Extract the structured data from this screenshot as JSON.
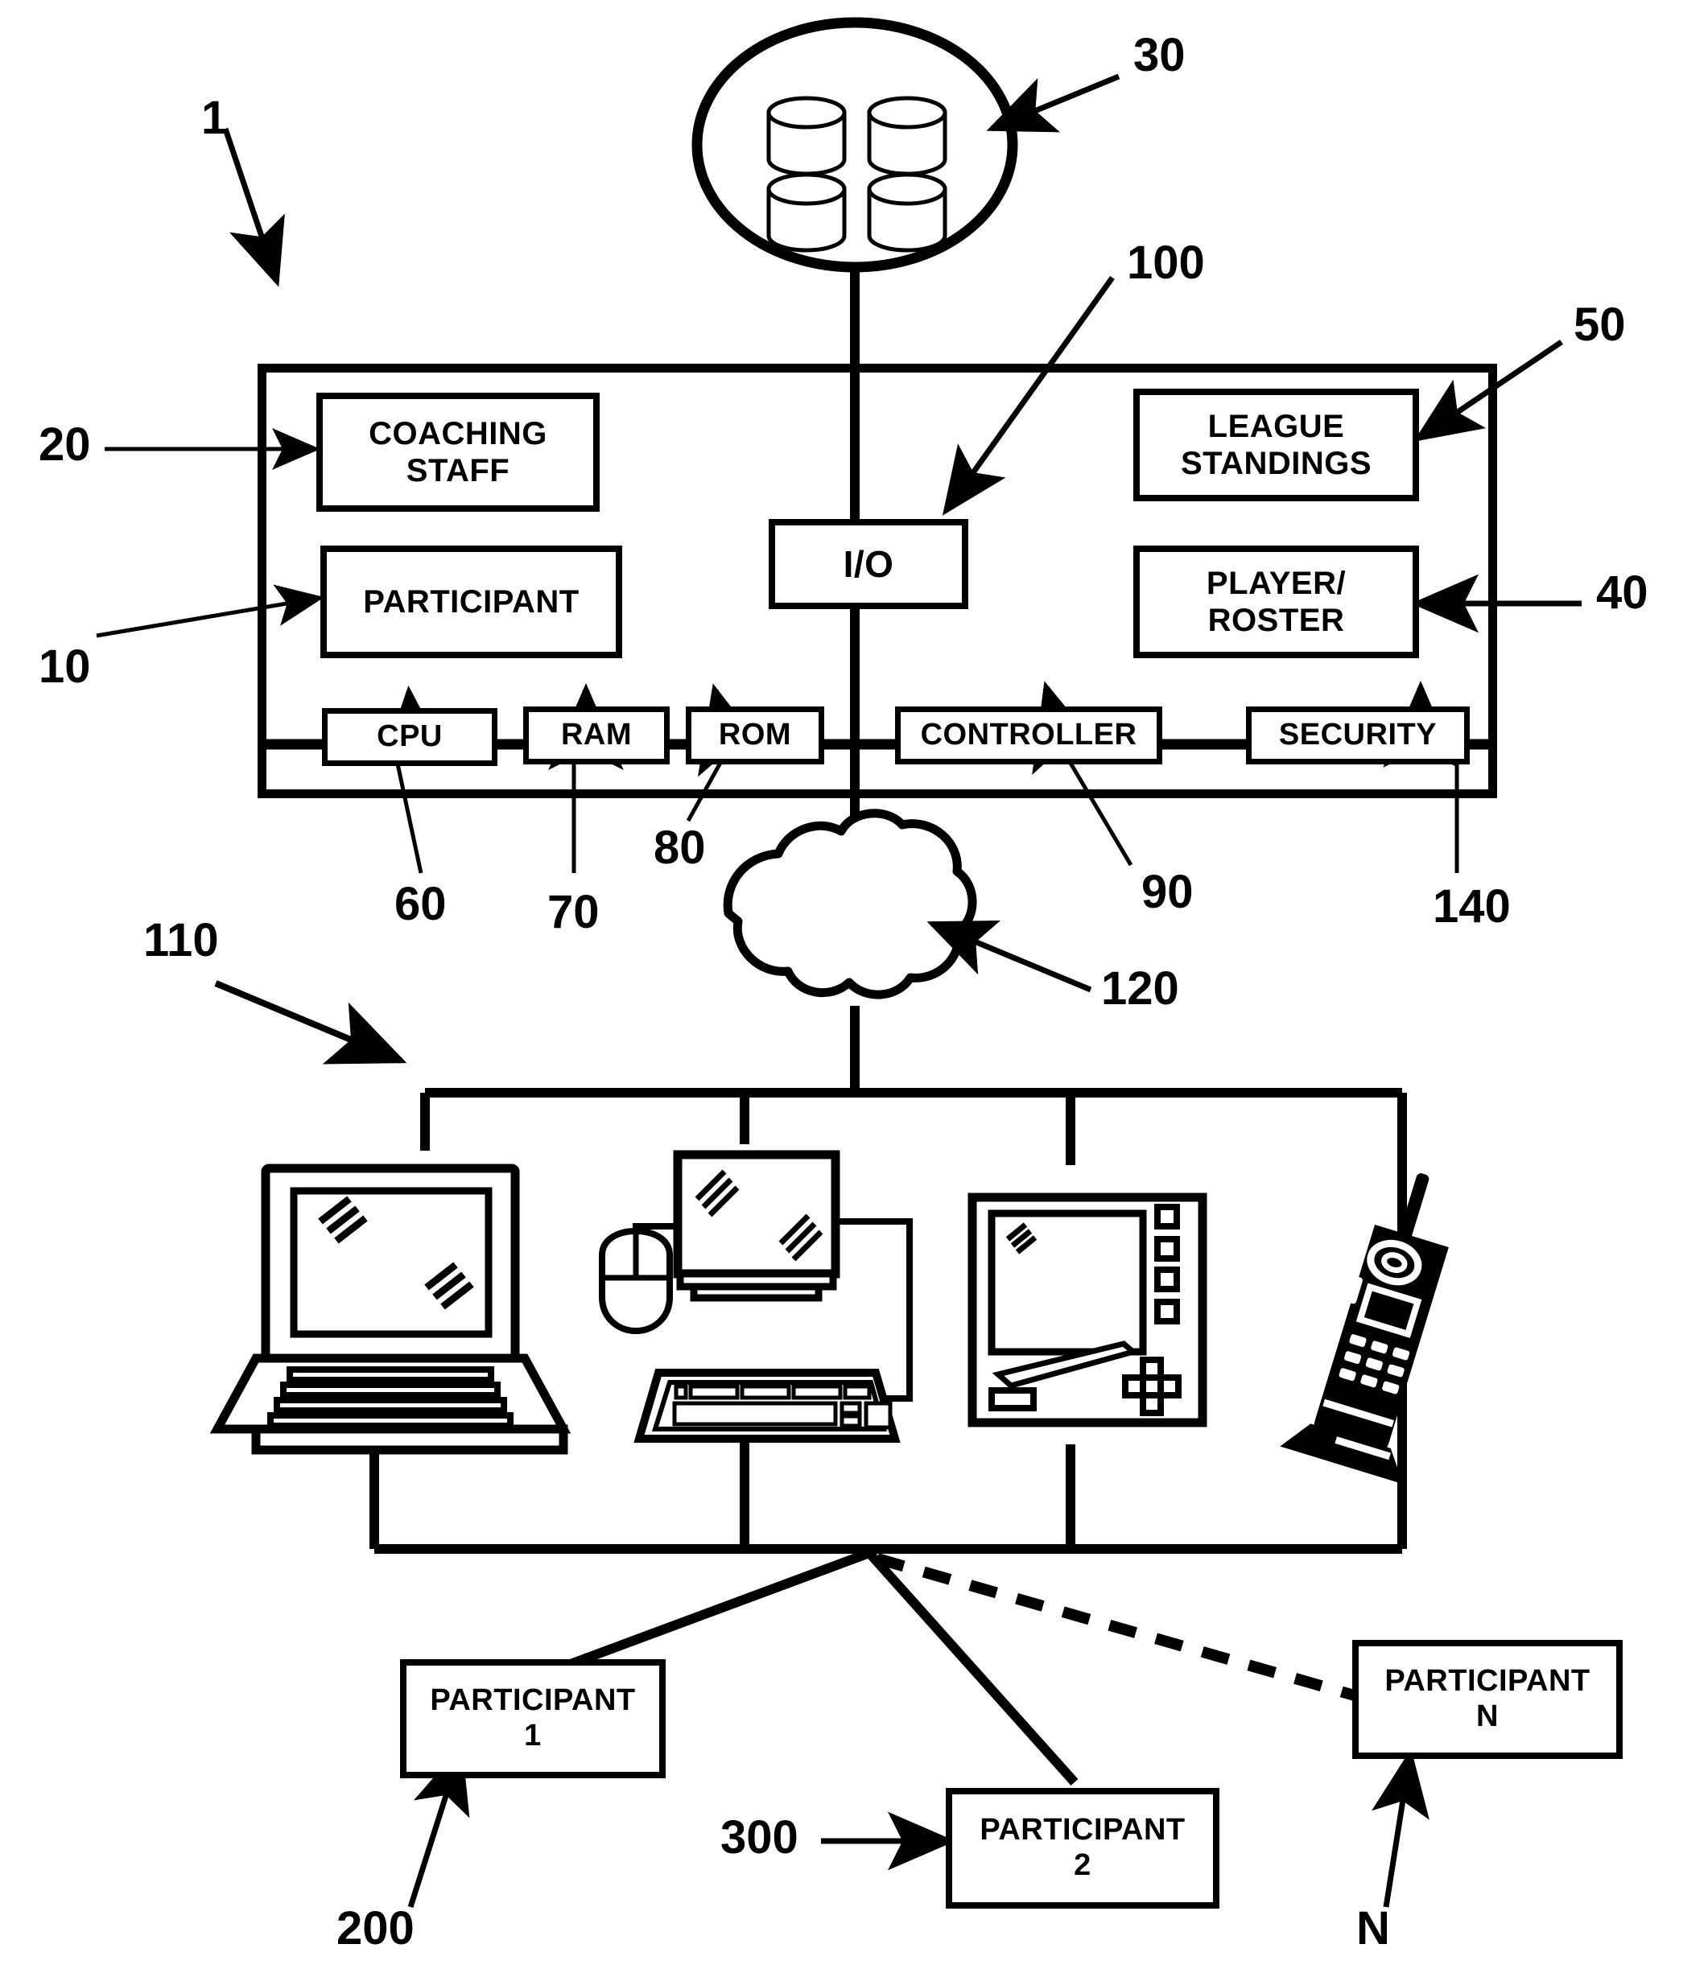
{
  "figure": {
    "type": "patent-system-block-diagram",
    "ink_color": "#000000",
    "background_color": "#ffffff"
  },
  "server_system": {
    "frame_ref": "1",
    "blocks": [
      {
        "id": "coaching_staff",
        "label": "COACHING\nSTAFF",
        "ref": "20"
      },
      {
        "id": "participant",
        "label": "PARTICIPANT",
        "ref": "10"
      },
      {
        "id": "io",
        "label": "I/O",
        "ref": "100"
      },
      {
        "id": "league_standings",
        "label": "LEAGUE\nSTANDINGS",
        "ref": "50"
      },
      {
        "id": "player_roster",
        "label": "PLAYER/\nROSTER",
        "ref": "40"
      },
      {
        "id": "cpu",
        "label": "CPU",
        "ref": "60"
      },
      {
        "id": "ram",
        "label": "RAM",
        "ref": "70"
      },
      {
        "id": "rom",
        "label": "ROM",
        "ref": "80"
      },
      {
        "id": "controller",
        "label": "CONTROLLER",
        "ref": "90"
      },
      {
        "id": "security",
        "label": "SECURITY",
        "ref": "140"
      }
    ]
  },
  "database": {
    "ref": "30",
    "icon": "database-cluster-icon",
    "cylinder_count": 4
  },
  "network": {
    "ref": "120",
    "icon": "cloud-icon"
  },
  "client_devices": {
    "ref": "110",
    "items": [
      {
        "id": "laptop",
        "icon": "laptop-icon"
      },
      {
        "id": "desktop",
        "icon": "desktop-computer-icon"
      },
      {
        "id": "pda",
        "icon": "pda-tablet-icon"
      },
      {
        "id": "mobile_phone",
        "icon": "mobile-phone-icon"
      }
    ]
  },
  "participants": [
    {
      "id": "participant_1",
      "label": "PARTICIPANT\n1",
      "ref": "200",
      "line_style": "solid"
    },
    {
      "id": "participant_2",
      "label": "PARTICIPANT\n2",
      "ref": "300",
      "line_style": "solid"
    },
    {
      "id": "participant_n",
      "label": "PARTICIPANT\nN",
      "ref": "N",
      "line_style": "dashed"
    }
  ],
  "reference_numerals": {
    "system": "1",
    "participant_module": "10",
    "coaching_staff_module": "20",
    "database": "30",
    "player_roster_module": "40",
    "league_standings_module": "50",
    "cpu": "60",
    "ram": "70",
    "rom": "80",
    "controller": "90",
    "io": "100",
    "client_tier": "110",
    "network_cloud": "120",
    "security": "140",
    "participant_1": "200",
    "participant_2": "300",
    "participant_n": "N"
  }
}
